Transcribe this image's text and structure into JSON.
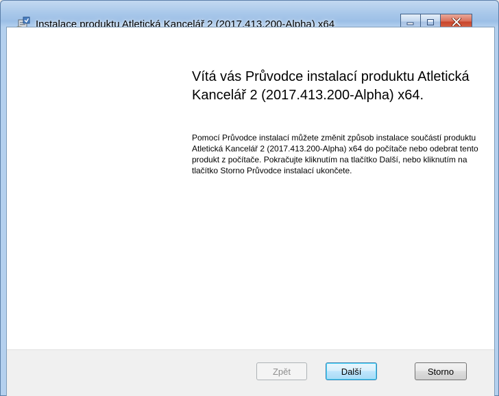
{
  "window": {
    "title": "Instalace produktu Atletická Kancelář 2 (2017.413.200-Alpha) x64"
  },
  "caption_buttons": {
    "minimize_icon": "minimize-icon",
    "maximize_icon": "maximize-icon",
    "close_icon": "close-icon"
  },
  "content": {
    "heading": "Vítá vás Průvodce instalací produktu Atletická Kancelář 2 (2017.413.200-Alpha) x64.",
    "description": "Pomocí Průvodce instalací můžete změnit způsob instalace součástí produktu Atletická Kancelář 2 (2017.413.200-Alpha) x64 do počítače nebo odebrat tento produkt z počítače. Pokračujte kliknutím na tlačítko Další, nebo kliknutím na tlačítko Storno Průvodce instalací ukončete."
  },
  "buttons": {
    "back": {
      "label": "Zpět",
      "enabled": false
    },
    "next": {
      "label": "Další",
      "enabled": true,
      "default": true
    },
    "cancel": {
      "label": "Storno",
      "enabled": true
    }
  },
  "colors": {
    "titlebar": "#a9c8ea",
    "close_button": "#c8452c",
    "bottom_bar": "#f0f0f0",
    "default_button_border": "#3c7fb1"
  }
}
